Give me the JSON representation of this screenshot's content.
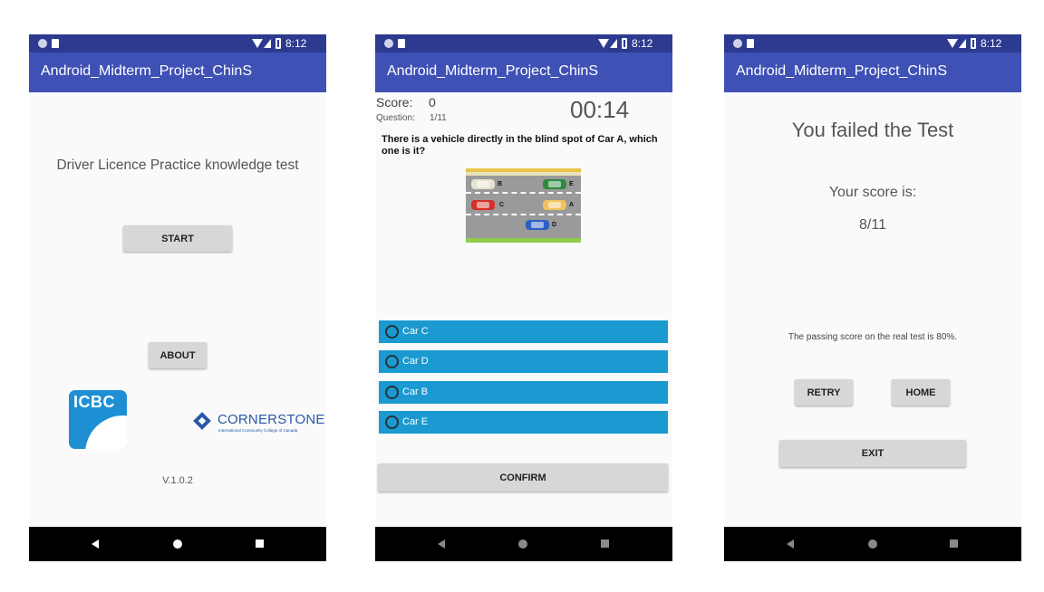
{
  "status_bar": {
    "time": "8:12"
  },
  "app_title": "Android_Midterm_Project_ChinS",
  "screen_home": {
    "heading": "Driver Licence Practice knowledge test",
    "start_label": "START",
    "about_label": "ABOUT",
    "icbc_logo_text": "ICBC",
    "partner_name": "CORNERSTONE",
    "partner_tagline": "International Community College of Canada",
    "version": "V.1.0.2"
  },
  "screen_quiz": {
    "score_label": "Score:",
    "score_value": "0",
    "question_label": "Question:",
    "question_progress": "1/11",
    "timer": "00:14",
    "question_text": "There is a vehicle directly in the blind spot of Car A, which one is it?",
    "diagram_cars": [
      {
        "label": "B",
        "color": "#e8e2d2"
      },
      {
        "label": "E",
        "color": "#2e8b3e"
      },
      {
        "label": "C",
        "color": "#d6302a"
      },
      {
        "label": "A",
        "color": "#f0c25a"
      },
      {
        "label": "D",
        "color": "#2d5fc4"
      }
    ],
    "options": [
      {
        "label": "Car C"
      },
      {
        "label": "Car D"
      },
      {
        "label": "Car B"
      },
      {
        "label": "Car E"
      }
    ],
    "confirm_label": "CONFIRM"
  },
  "screen_result": {
    "headline": "You failed the Test",
    "score_caption": "Your score is:",
    "score_value": "8/11",
    "passing_note": "The passing score on the real test is 80%.",
    "retry_label": "RETRY",
    "home_label": "HOME",
    "exit_label": "EXIT"
  },
  "colors": {
    "status_bar": "#2c3b8f",
    "app_bar": "#3f51b5",
    "option_fill": "#1a9ad1",
    "button_fill": "#d6d7d7",
    "icbc_blue": "#1f8fd4",
    "cornerstone_blue": "#2a58a8"
  }
}
